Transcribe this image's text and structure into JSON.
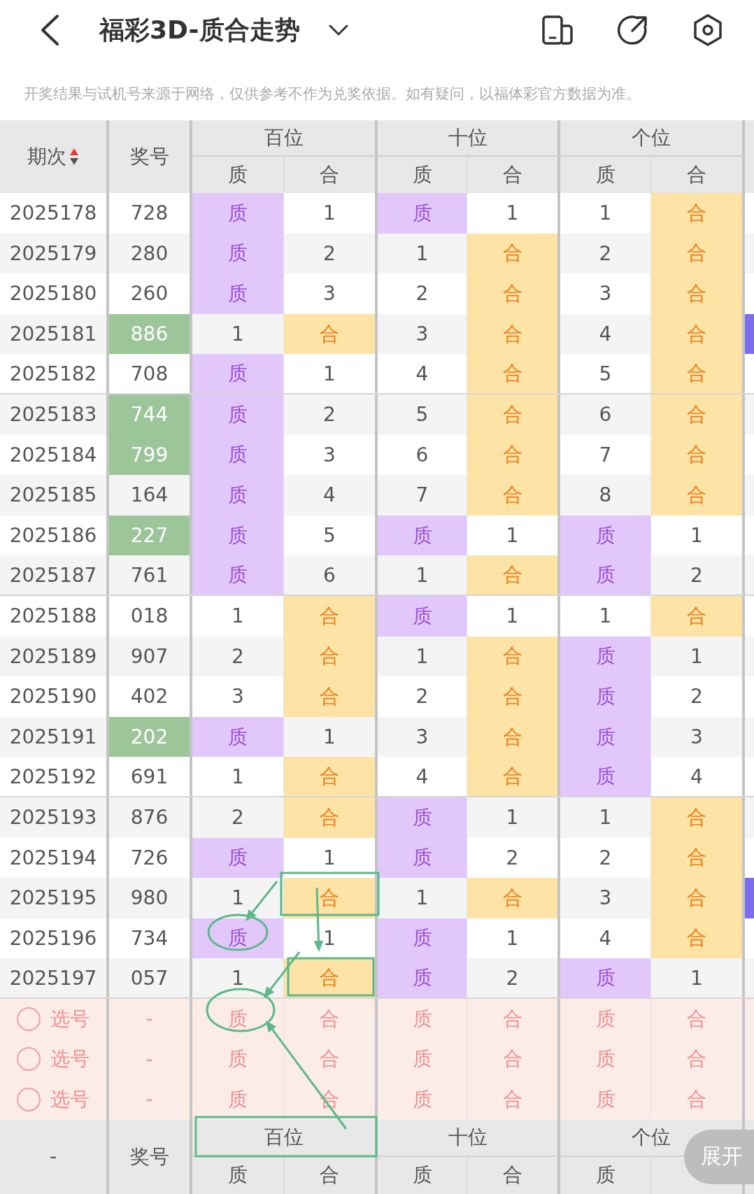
{
  "header": {
    "title": "福彩3D-质合走势"
  },
  "notice": "开奖结果与试机号来源于网络，仅供参考不作为兑奖依据。如有疑问，以福体彩官方数据为准。",
  "table": {
    "period_label": "期次",
    "number_label": "奖号",
    "groups": [
      {
        "label": "百位",
        "columns": [
          "质",
          "合"
        ]
      },
      {
        "label": "十位",
        "columns": [
          "质",
          "合"
        ]
      },
      {
        "label": "个位",
        "columns": [
          "质",
          "合"
        ]
      }
    ],
    "rows": [
      {
        "period": "2025178",
        "number": "728",
        "highlighted": false,
        "edge_marker": false,
        "cells": [
          {
            "text": "质",
            "hit": true
          },
          {
            "text": "1",
            "hit": false
          },
          {
            "text": "质",
            "hit": true
          },
          {
            "text": "1",
            "hit": false
          },
          {
            "text": "1",
            "hit": false
          },
          {
            "text": "合",
            "hit": true
          }
        ]
      },
      {
        "period": "2025179",
        "number": "280",
        "highlighted": false,
        "edge_marker": false,
        "cells": [
          {
            "text": "质",
            "hit": true
          },
          {
            "text": "2",
            "hit": false
          },
          {
            "text": "1",
            "hit": false
          },
          {
            "text": "合",
            "hit": true
          },
          {
            "text": "2",
            "hit": false
          },
          {
            "text": "合",
            "hit": true
          }
        ]
      },
      {
        "period": "2025180",
        "number": "260",
        "highlighted": false,
        "edge_marker": false,
        "cells": [
          {
            "text": "质",
            "hit": true
          },
          {
            "text": "3",
            "hit": false
          },
          {
            "text": "2",
            "hit": false
          },
          {
            "text": "合",
            "hit": true
          },
          {
            "text": "3",
            "hit": false
          },
          {
            "text": "合",
            "hit": true
          }
        ]
      },
      {
        "period": "2025181",
        "number": "886",
        "highlighted": true,
        "edge_marker": true,
        "cells": [
          {
            "text": "1",
            "hit": false
          },
          {
            "text": "合",
            "hit": true
          },
          {
            "text": "3",
            "hit": false
          },
          {
            "text": "合",
            "hit": true
          },
          {
            "text": "4",
            "hit": false
          },
          {
            "text": "合",
            "hit": true
          }
        ]
      },
      {
        "period": "2025182",
        "number": "708",
        "highlighted": false,
        "edge_marker": false,
        "cells": [
          {
            "text": "质",
            "hit": true
          },
          {
            "text": "1",
            "hit": false
          },
          {
            "text": "4",
            "hit": false
          },
          {
            "text": "合",
            "hit": true
          },
          {
            "text": "5",
            "hit": false
          },
          {
            "text": "合",
            "hit": true
          }
        ]
      },
      {
        "period": "2025183",
        "number": "744",
        "highlighted": true,
        "edge_marker": false,
        "cells": [
          {
            "text": "质",
            "hit": true
          },
          {
            "text": "2",
            "hit": false
          },
          {
            "text": "5",
            "hit": false
          },
          {
            "text": "合",
            "hit": true
          },
          {
            "text": "6",
            "hit": false
          },
          {
            "text": "合",
            "hit": true
          }
        ]
      },
      {
        "period": "2025184",
        "number": "799",
        "highlighted": true,
        "edge_marker": false,
        "cells": [
          {
            "text": "质",
            "hit": true
          },
          {
            "text": "3",
            "hit": false
          },
          {
            "text": "6",
            "hit": false
          },
          {
            "text": "合",
            "hit": true
          },
          {
            "text": "7",
            "hit": false
          },
          {
            "text": "合",
            "hit": true
          }
        ]
      },
      {
        "period": "2025185",
        "number": "164",
        "highlighted": false,
        "edge_marker": false,
        "cells": [
          {
            "text": "质",
            "hit": true
          },
          {
            "text": "4",
            "hit": false
          },
          {
            "text": "7",
            "hit": false
          },
          {
            "text": "合",
            "hit": true
          },
          {
            "text": "8",
            "hit": false
          },
          {
            "text": "合",
            "hit": true
          }
        ]
      },
      {
        "period": "2025186",
        "number": "227",
        "highlighted": true,
        "edge_marker": false,
        "cells": [
          {
            "text": "质",
            "hit": true
          },
          {
            "text": "5",
            "hit": false
          },
          {
            "text": "质",
            "hit": true
          },
          {
            "text": "1",
            "hit": false
          },
          {
            "text": "质",
            "hit": true
          },
          {
            "text": "1",
            "hit": false
          }
        ]
      },
      {
        "period": "2025187",
        "number": "761",
        "highlighted": false,
        "edge_marker": false,
        "cells": [
          {
            "text": "质",
            "hit": true
          },
          {
            "text": "6",
            "hit": false
          },
          {
            "text": "1",
            "hit": false
          },
          {
            "text": "合",
            "hit": true
          },
          {
            "text": "质",
            "hit": true
          },
          {
            "text": "2",
            "hit": false
          }
        ]
      },
      {
        "period": "2025188",
        "number": "018",
        "highlighted": false,
        "edge_marker": false,
        "cells": [
          {
            "text": "1",
            "hit": false
          },
          {
            "text": "合",
            "hit": true
          },
          {
            "text": "质",
            "hit": true
          },
          {
            "text": "1",
            "hit": false
          },
          {
            "text": "1",
            "hit": false
          },
          {
            "text": "合",
            "hit": true
          }
        ]
      },
      {
        "period": "2025189",
        "number": "907",
        "highlighted": false,
        "edge_marker": false,
        "cells": [
          {
            "text": "2",
            "hit": false
          },
          {
            "text": "合",
            "hit": true
          },
          {
            "text": "1",
            "hit": false
          },
          {
            "text": "合",
            "hit": true
          },
          {
            "text": "质",
            "hit": true
          },
          {
            "text": "1",
            "hit": false
          }
        ]
      },
      {
        "period": "2025190",
        "number": "402",
        "highlighted": false,
        "edge_marker": false,
        "cells": [
          {
            "text": "3",
            "hit": false
          },
          {
            "text": "合",
            "hit": true
          },
          {
            "text": "2",
            "hit": false
          },
          {
            "text": "合",
            "hit": true
          },
          {
            "text": "质",
            "hit": true
          },
          {
            "text": "2",
            "hit": false
          }
        ]
      },
      {
        "period": "2025191",
        "number": "202",
        "highlighted": true,
        "edge_marker": false,
        "cells": [
          {
            "text": "质",
            "hit": true
          },
          {
            "text": "1",
            "hit": false
          },
          {
            "text": "3",
            "hit": false
          },
          {
            "text": "合",
            "hit": true
          },
          {
            "text": "质",
            "hit": true
          },
          {
            "text": "3",
            "hit": false
          }
        ]
      },
      {
        "period": "2025192",
        "number": "691",
        "highlighted": false,
        "edge_marker": false,
        "cells": [
          {
            "text": "1",
            "hit": false
          },
          {
            "text": "合",
            "hit": true
          },
          {
            "text": "4",
            "hit": false
          },
          {
            "text": "合",
            "hit": true
          },
          {
            "text": "质",
            "hit": true
          },
          {
            "text": "4",
            "hit": false
          }
        ]
      },
      {
        "period": "2025193",
        "number": "876",
        "highlighted": false,
        "edge_marker": false,
        "cells": [
          {
            "text": "2",
            "hit": false
          },
          {
            "text": "合",
            "hit": true
          },
          {
            "text": "质",
            "hit": true
          },
          {
            "text": "1",
            "hit": false
          },
          {
            "text": "1",
            "hit": false
          },
          {
            "text": "合",
            "hit": true
          }
        ]
      },
      {
        "period": "2025194",
        "number": "726",
        "highlighted": false,
        "edge_marker": false,
        "cells": [
          {
            "text": "质",
            "hit": true
          },
          {
            "text": "1",
            "hit": false
          },
          {
            "text": "质",
            "hit": true
          },
          {
            "text": "2",
            "hit": false
          },
          {
            "text": "2",
            "hit": false
          },
          {
            "text": "合",
            "hit": true
          }
        ]
      },
      {
        "period": "2025195",
        "number": "980",
        "highlighted": false,
        "edge_marker": true,
        "cells": [
          {
            "text": "1",
            "hit": false
          },
          {
            "text": "合",
            "hit": true
          },
          {
            "text": "1",
            "hit": false
          },
          {
            "text": "合",
            "hit": true
          },
          {
            "text": "3",
            "hit": false
          },
          {
            "text": "合",
            "hit": true
          }
        ]
      },
      {
        "period": "2025196",
        "number": "734",
        "highlighted": false,
        "edge_marker": false,
        "cells": [
          {
            "text": "质",
            "hit": true
          },
          {
            "text": "1",
            "hit": false
          },
          {
            "text": "质",
            "hit": true
          },
          {
            "text": "1",
            "hit": false
          },
          {
            "text": "4",
            "hit": false
          },
          {
            "text": "合",
            "hit": true
          }
        ]
      },
      {
        "period": "2025197",
        "number": "057",
        "highlighted": false,
        "edge_marker": false,
        "cells": [
          {
            "text": "1",
            "hit": false
          },
          {
            "text": "合",
            "hit": true
          },
          {
            "text": "质",
            "hit": true
          },
          {
            "text": "2",
            "hit": false
          },
          {
            "text": "质",
            "hit": true
          },
          {
            "text": "1",
            "hit": false
          }
        ]
      }
    ],
    "pick_rows": [
      {
        "selected": false,
        "label": "选号",
        "number": "-",
        "cells": [
          "质",
          "合",
          "质",
          "合",
          "质",
          "合"
        ]
      },
      {
        "selected": false,
        "label": "选号",
        "number": "-",
        "cells": [
          "质",
          "合",
          "质",
          "合",
          "质",
          "合"
        ]
      },
      {
        "selected": false,
        "label": "选号",
        "number": "-",
        "cells": [
          "质",
          "合",
          "质",
          "合",
          "质",
          "合"
        ]
      }
    ],
    "footer": {
      "period_label": "-",
      "number_label": "奖号",
      "groups": [
        {
          "label": "百位",
          "columns": [
            "质",
            "合"
          ]
        },
        {
          "label": "十位",
          "columns": [
            "质",
            "合"
          ]
        },
        {
          "label": "个位",
          "columns": [
            "质"
          ]
        }
      ]
    }
  },
  "expand_button": "展开"
}
